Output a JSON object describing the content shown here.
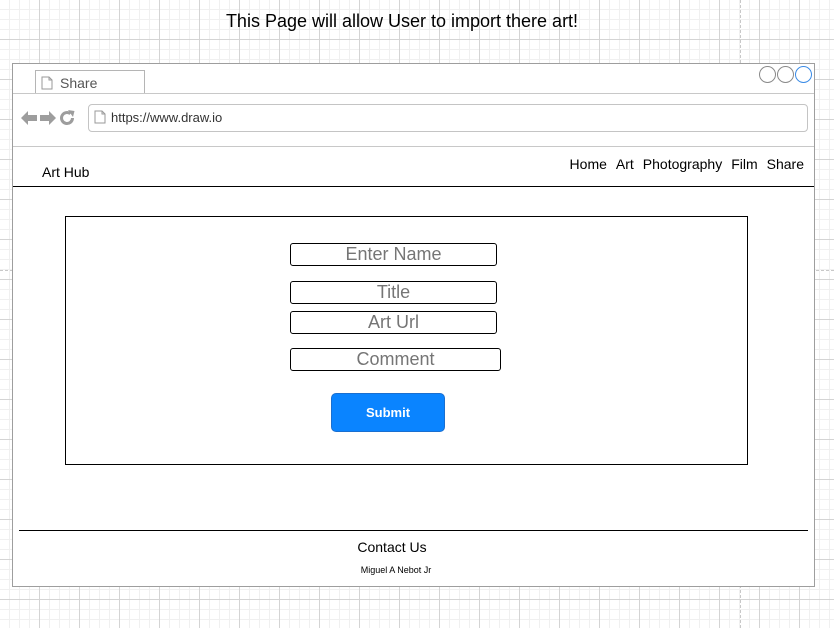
{
  "caption": "This Page will allow User to import there art!",
  "browser": {
    "tab_label": "Share",
    "url": "https://www.draw.io",
    "accent_color": "#3a8be6"
  },
  "header": {
    "brand": "Art Hub",
    "nav": [
      "Home",
      "Art",
      "Photography",
      "Film",
      "Share"
    ]
  },
  "form": {
    "name_placeholder": "Enter Name",
    "title_placeholder": "Title",
    "url_placeholder": "Art Url",
    "comment_placeholder": "Comment",
    "submit_label": "Submit",
    "submit_color": "#0a84ff"
  },
  "footer": {
    "title": "Contact Us",
    "credit": "Miguel A Nebot Jr"
  },
  "icons": [
    "page-icon",
    "back-arrow-icon",
    "forward-arrow-icon",
    "reload-icon",
    "window-circle-icon"
  ]
}
